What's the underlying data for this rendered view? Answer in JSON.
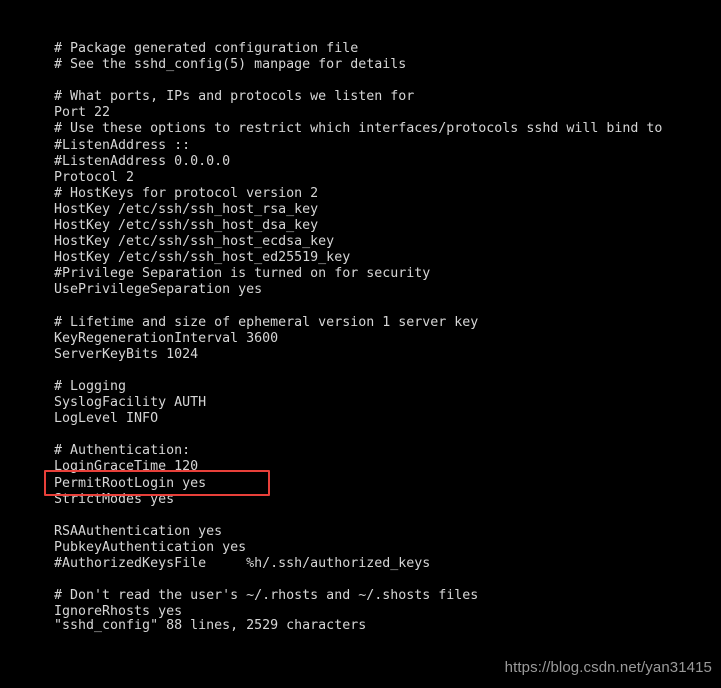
{
  "terminal": {
    "background_color": "#000000",
    "text_color": "#d6d6d6",
    "filename": "sshd_config"
  },
  "editor": {
    "lines": [
      "# Package generated configuration file",
      "# See the sshd_config(5) manpage for details",
      "",
      "# What ports, IPs and protocols we listen for",
      "Port 22",
      "# Use these options to restrict which interfaces/protocols sshd will bind to",
      "#ListenAddress ::",
      "#ListenAddress 0.0.0.0",
      "Protocol 2",
      "# HostKeys for protocol version 2",
      "HostKey /etc/ssh/ssh_host_rsa_key",
      "HostKey /etc/ssh/ssh_host_dsa_key",
      "HostKey /etc/ssh/ssh_host_ecdsa_key",
      "HostKey /etc/ssh/ssh_host_ed25519_key",
      "#Privilege Separation is turned on for security",
      "UsePrivilegeSeparation yes",
      "",
      "# Lifetime and size of ephemeral version 1 server key",
      "KeyRegenerationInterval 3600",
      "ServerKeyBits 1024",
      "",
      "# Logging",
      "SyslogFacility AUTH",
      "LogLevel INFO",
      "",
      "# Authentication:",
      "LoginGraceTime 120",
      "PermitRootLogin yes",
      "StrictModes yes",
      "",
      "RSAAuthentication yes",
      "PubkeyAuthentication yes",
      "#AuthorizedKeysFile     %h/.ssh/authorized_keys",
      "",
      "# Don't read the user's ~/.rhosts and ~/.shosts files",
      "IgnoreRhosts yes"
    ]
  },
  "status": {
    "text": "\"sshd_config\" 88 lines, 2529 characters"
  },
  "highlight": {
    "target_line": "PermitRootLogin yes",
    "color": "#e8403a"
  },
  "watermark": {
    "text": "https://blog.csdn.net/yan31415",
    "color": "#9a9a9a"
  }
}
